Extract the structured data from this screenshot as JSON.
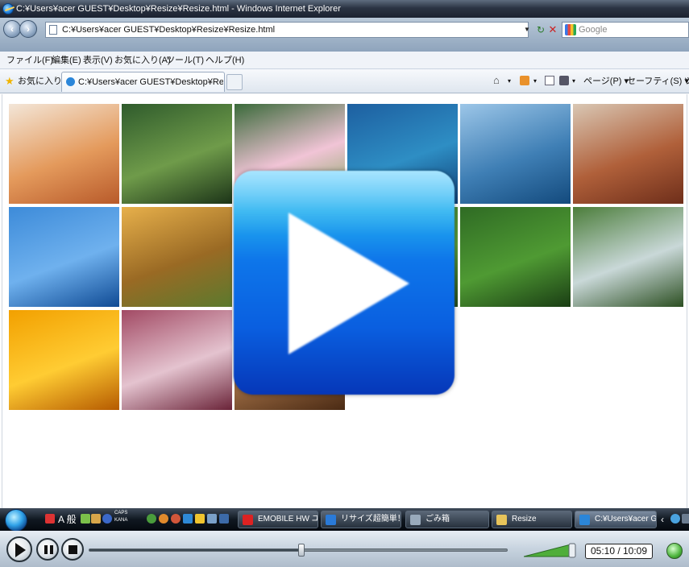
{
  "window": {
    "title": "C:¥Users¥acer GUEST¥Desktop¥Resize¥Resize.html - Windows Internet Explorer"
  },
  "address_bar": {
    "url": "C:¥Users¥acer GUEST¥Desktop¥Resize¥Resize.html"
  },
  "search": {
    "placeholder": "Google"
  },
  "menu": {
    "items": [
      "ファイル(F)",
      "編集(E)",
      "表示(V)",
      "お気に入り(A)",
      "ツール(T)",
      "ヘルプ(H)"
    ]
  },
  "favorites": {
    "label": "お気に入り"
  },
  "tab": {
    "title": "C:¥Users¥acer GUEST¥Desktop¥Resize¥Res..."
  },
  "toolbar": {
    "page_label": "ページ(P) ▾",
    "safety_label": "セーフティ(S) ▾",
    "tools_cut": "ツ"
  },
  "gallery": {
    "tiles": [
      {
        "name": "desert-oryx-tile",
        "colors": [
          "#f3e6d8",
          "#e49a5c",
          "#b85a2a"
        ]
      },
      {
        "name": "toucan-tile",
        "colors": [
          "#2f5b2c",
          "#6f9b4a",
          "#1c3418"
        ]
      },
      {
        "name": "frangipani-tile",
        "colors": [
          "#3a6a3a",
          "#f1c4d6",
          "#7da65a"
        ]
      },
      {
        "name": "sea-turtle-tile",
        "colors": [
          "#1d5fa0",
          "#2e8ec4",
          "#0f3e74"
        ]
      },
      {
        "name": "whale-tail-tile",
        "colors": [
          "#9cc6e8",
          "#3f7fb5",
          "#134a7d"
        ]
      },
      {
        "name": "monument-valley-tile",
        "colors": [
          "#d9c7b4",
          "#b0603a",
          "#6e2e1a"
        ]
      },
      {
        "name": "dock-sky-tile",
        "colors": [
          "#3d8bd9",
          "#6fb1ee",
          "#0f4a94"
        ]
      },
      {
        "name": "autumn-tree-tile",
        "colors": [
          "#e7b04b",
          "#9a6a24",
          "#5b7a2e"
        ]
      },
      {
        "name": "hidden-tile-1",
        "colors": [
          "#6fa2d0",
          "#3b6fa8",
          "#20406b"
        ]
      },
      {
        "name": "hidden-tile-2",
        "colors": [
          "#3d7b2f",
          "#5a9a3a",
          "#254a1c"
        ]
      },
      {
        "name": "pink-flowers-tile",
        "colors": [
          "#2f6b24",
          "#4f9a33",
          "#1a3d14"
        ]
      },
      {
        "name": "waterfall-tile",
        "colors": [
          "#4b7d3a",
          "#c9d8d8",
          "#2c4f22"
        ]
      },
      {
        "name": "orange-daisies-tile",
        "colors": [
          "#f2a000",
          "#ffcc33",
          "#b55a00"
        ]
      },
      {
        "name": "frost-leaves-tile",
        "colors": [
          "#a24a64",
          "#e4c3cf",
          "#6a2338"
        ]
      },
      {
        "name": "wood-tile",
        "colors": [
          "#7a4a2a",
          "#9a6a42",
          "#4a2a14"
        ]
      }
    ]
  },
  "taskbar": {
    "ime_label": "A 般",
    "caps_label": "CAPS",
    "kana_label": "KANA",
    "buttons": [
      {
        "label": "EMOBILE HW ユ...",
        "icon_color": "#d22"
      },
      {
        "label": "リサイズ超簡単！...",
        "icon_color": "#2a7ad8"
      },
      {
        "label": "ごみ箱",
        "icon_color": "#9ab"
      },
      {
        "label": "Resize",
        "icon_color": "#e8c45a"
      },
      {
        "label": "C:¥Users¥acer G...",
        "icon_color": "#2b86d9"
      }
    ]
  },
  "player": {
    "time": "05:10 / 10:09",
    "progress": 0.5
  }
}
